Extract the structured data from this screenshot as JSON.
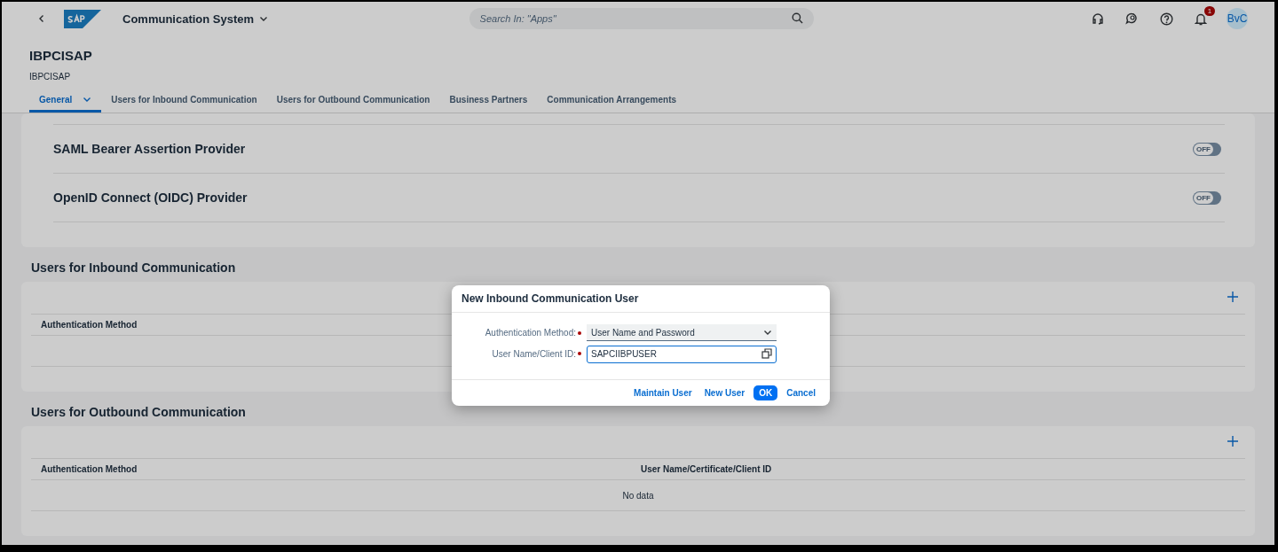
{
  "shell": {
    "title": "Communication System",
    "search": {
      "placeholder": "Search In: \"Apps\""
    },
    "notification_count": "1",
    "avatar": "BvC"
  },
  "header": {
    "title": "IBPCISAP",
    "subtitle": "IBPCISAP"
  },
  "tabs": [
    {
      "label": "General",
      "selected": true,
      "has_menu": true
    },
    {
      "label": "Users for Inbound Communication",
      "selected": false,
      "has_menu": false
    },
    {
      "label": "Users for Outbound Communication",
      "selected": false,
      "has_menu": false
    },
    {
      "label": "Business Partners",
      "selected": false,
      "has_menu": false
    },
    {
      "label": "Communication Arrangements",
      "selected": false,
      "has_menu": false
    }
  ],
  "providers": [
    {
      "name": "SAML Bearer Assertion Provider",
      "toggle": "OFF",
      "on": false
    },
    {
      "name": "OpenID Connect (OIDC) Provider",
      "toggle": "OFF",
      "on": false
    }
  ],
  "sections": [
    {
      "title": "Users for Inbound Communication",
      "columns": [
        "Authentication Method"
      ]
    },
    {
      "title": "Users for Outbound Communication",
      "columns": [
        "Authentication Method",
        "User Name/Certificate/Client ID"
      ],
      "empty_text": "No data"
    }
  ],
  "dialog": {
    "title": "New Inbound Communication User",
    "fields": [
      {
        "kind": "select",
        "label": "Authentication Method:",
        "required": true,
        "value": "User Name and Password"
      },
      {
        "kind": "input",
        "label": "User Name/Client ID:",
        "required": true,
        "value": "SAPCIIBPUSER"
      }
    ],
    "buttons": [
      {
        "label": "Maintain User",
        "emphasized": false
      },
      {
        "label": "New User",
        "emphasized": false
      },
      {
        "label": "OK",
        "emphasized": true
      },
      {
        "label": "Cancel",
        "emphasized": false
      }
    ]
  }
}
